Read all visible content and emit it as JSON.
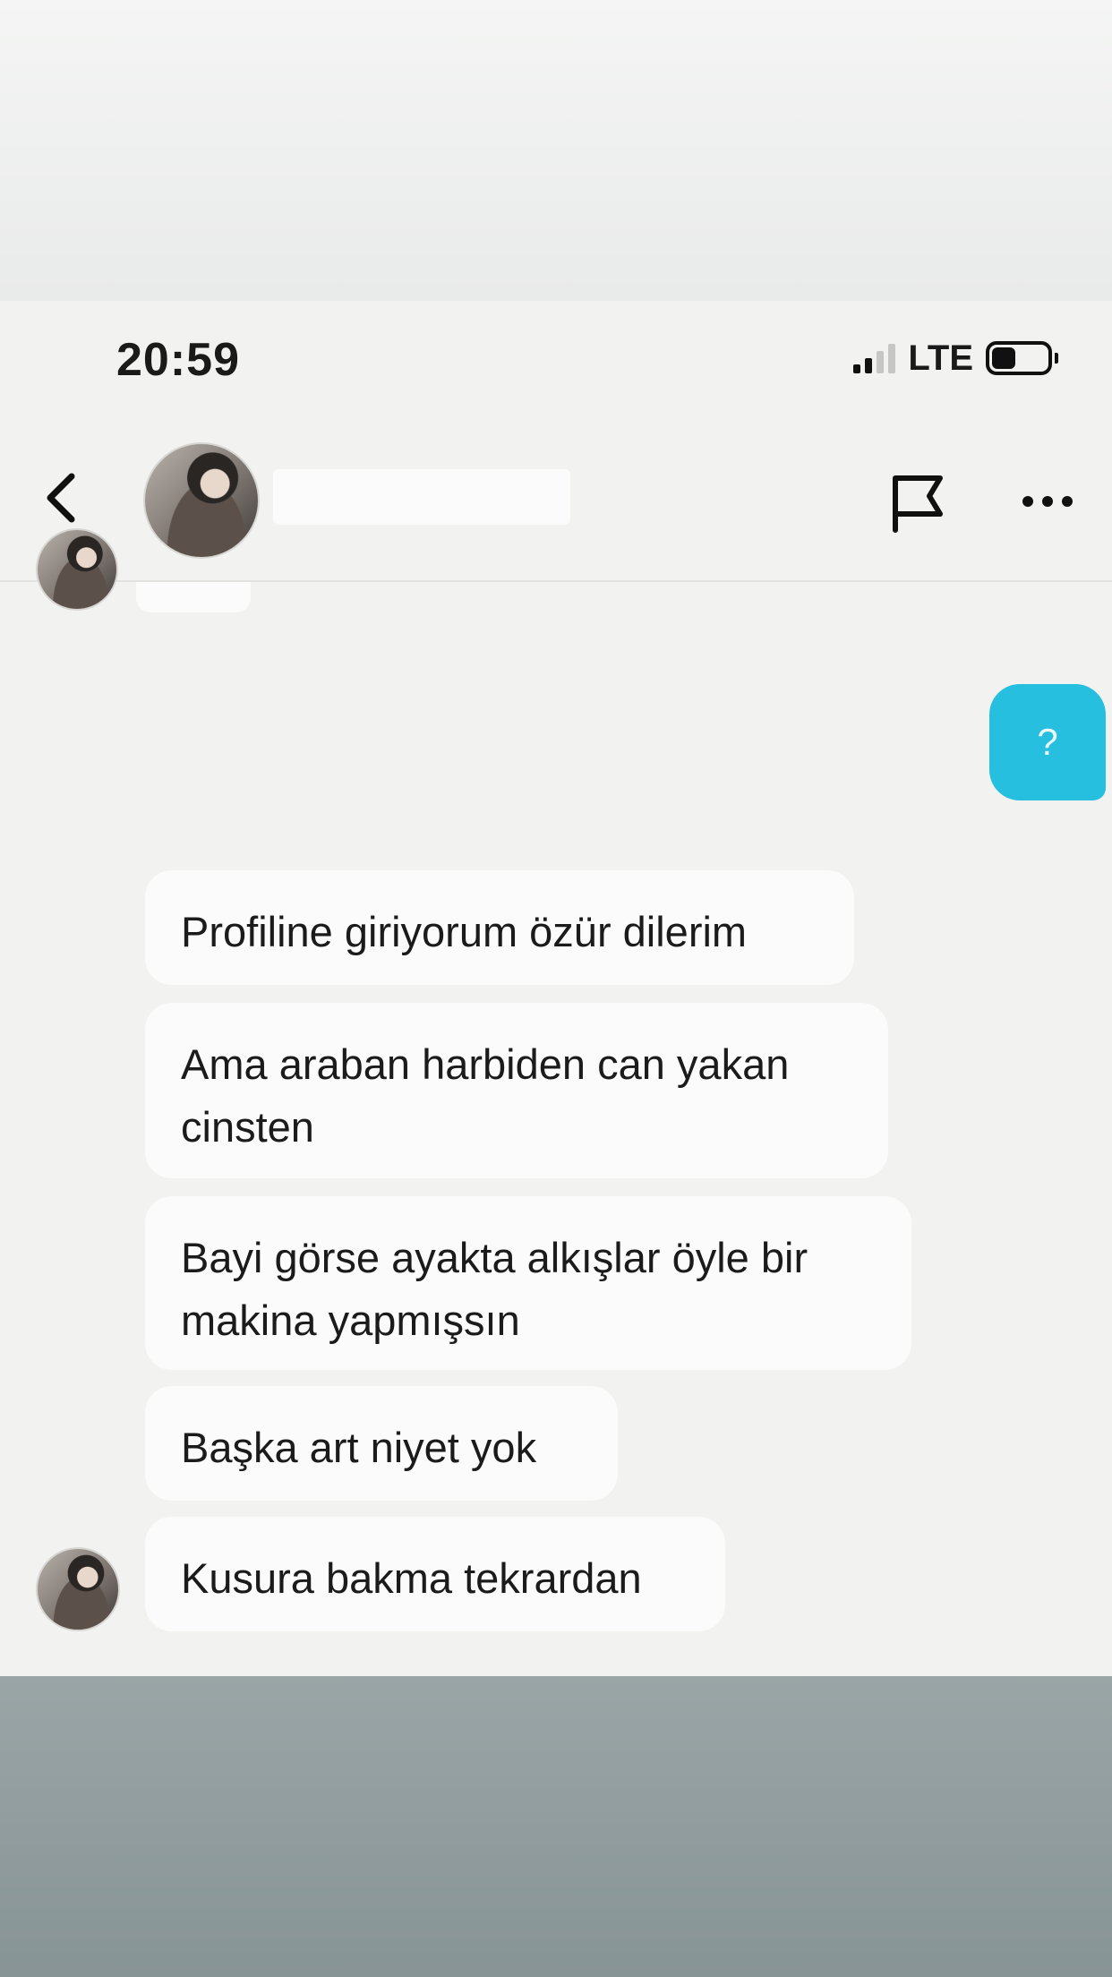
{
  "status_bar": {
    "time": "20:59",
    "network": "LTE"
  },
  "header": {
    "back_icon": "chevron-left-icon",
    "flag_icon": "flag-icon",
    "more_icon": "more-horizontal-icon"
  },
  "colors": {
    "outgoing_bubble": "#27bfe0",
    "incoming_bubble": "#fbfbfb",
    "background": "#f2f2f1"
  },
  "messages": {
    "outgoing": [
      {
        "text": "?"
      }
    ],
    "incoming": [
      {
        "lines": [
          "Profiline giriyorum özür dilerim"
        ]
      },
      {
        "lines": [
          "Ama araban harbiden can yakan",
          "cinsten"
        ]
      },
      {
        "lines": [
          "Bayi görse ayakta alkışlar öyle bir",
          "makina yapmışsın"
        ]
      },
      {
        "lines": [
          "Başka art niyet yok"
        ]
      },
      {
        "lines": [
          "Kusura bakma tekrardan"
        ]
      }
    ]
  }
}
